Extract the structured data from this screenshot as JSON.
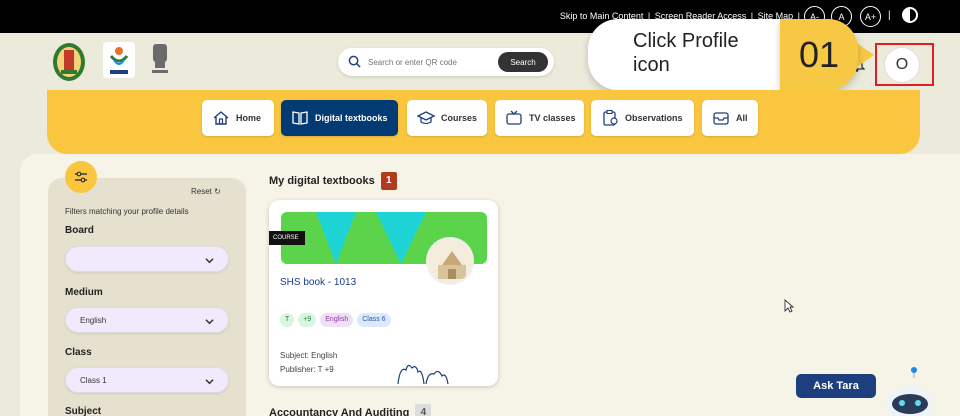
{
  "topbar": {
    "links": [
      "Skip to Main Content",
      "Screen Reader Access",
      "Site Map"
    ],
    "font_sizes": [
      "A-",
      "A",
      "A+"
    ]
  },
  "header": {
    "search": {
      "placeholder": "Search or enter QR code",
      "button": "Search"
    },
    "profile_initial": "O"
  },
  "callout": {
    "text": "Click Profile icon",
    "step": "01"
  },
  "nav": {
    "tabs": [
      {
        "label": "Home",
        "icon": "home-icon",
        "active": false
      },
      {
        "label": "Digital textbooks",
        "icon": "book-icon",
        "active": true
      },
      {
        "label": "Courses",
        "icon": "graduation-cap-icon",
        "active": false
      },
      {
        "label": "TV classes",
        "icon": "tv-icon",
        "active": false
      },
      {
        "label": "Observations",
        "icon": "clipboard-icon",
        "active": false
      },
      {
        "label": "All",
        "icon": "inbox-icon",
        "active": false
      }
    ]
  },
  "filters": {
    "reset": "Reset",
    "hint": "Filters matching your profile details",
    "board": {
      "label": "Board",
      "value": ""
    },
    "medium": {
      "label": "Medium",
      "value": "English"
    },
    "class": {
      "label": "Class",
      "value": "Class 1"
    },
    "subject": {
      "label": "Subject"
    }
  },
  "sections": [
    {
      "title": "My digital textbooks",
      "count": "1"
    },
    {
      "title": "Accountancy And Auditing",
      "count": "4"
    }
  ],
  "card": {
    "tag": "COURSE",
    "title": "SHS book - 1013",
    "chips": [
      "T",
      "+9",
      "English",
      "Class 6"
    ],
    "subject": "Subject: English",
    "publisher": "Publisher: T +9"
  },
  "assistant": {
    "label": "Ask Tara"
  },
  "colors": {
    "accent_yellow": "#fbc63f",
    "nav_active": "#023a74",
    "count_badge": "#b23b1e",
    "highlight_red": "#e02020"
  }
}
